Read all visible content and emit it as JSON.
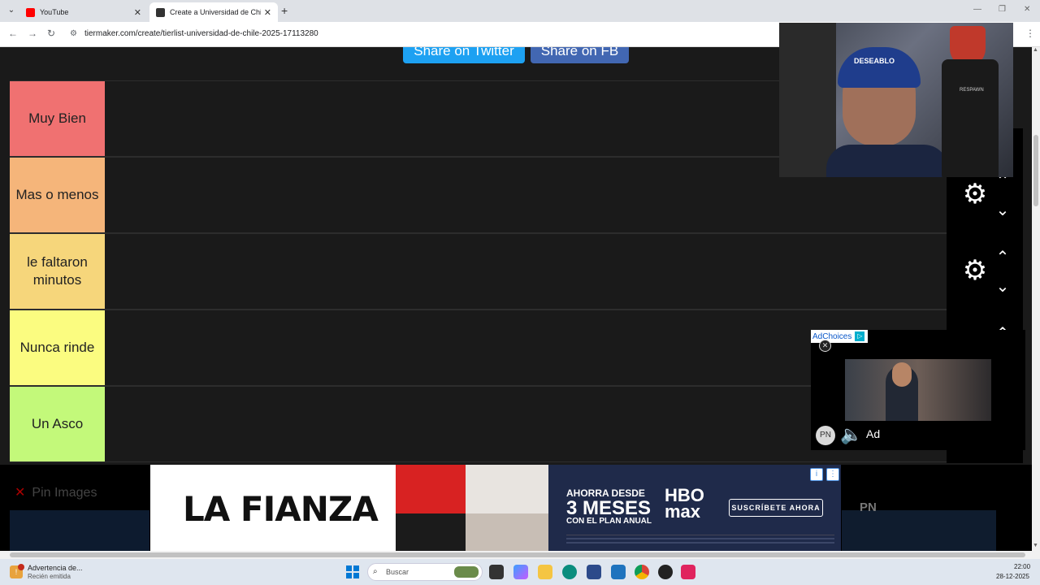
{
  "browser": {
    "tabs": [
      {
        "title": "YouTube",
        "active": false
      },
      {
        "title": "Create a Universidad de Chile Ti",
        "active": true
      }
    ],
    "url": "tiermaker.com/create/tierlist-universidad-de-chile-2025-17113280"
  },
  "share": {
    "twitter_label": "Share on Twitter",
    "facebook_label": "Share on FB"
  },
  "tiers": [
    {
      "label": "Muy Bien",
      "color": "#f07171"
    },
    {
      "label": "Mas o menos",
      "color": "#f5b57a"
    },
    {
      "label": "le faltaron minutos",
      "color": "#f6d67b"
    },
    {
      "label": "Nunca rinde",
      "color": "#fbfc80"
    },
    {
      "label": "Un Asco",
      "color": "#c3f97a"
    }
  ],
  "webcam": {
    "cap_text": "DESEABLO",
    "mic_brand": "RESPAWN"
  },
  "ad_popup": {
    "adchoices_label": "AdChoices",
    "badge": "PN",
    "ad_label": "Ad"
  },
  "bottom": {
    "pin_images_label": "Pin Images",
    "banner_title": "LA FIANZA",
    "promo_line1": "AHORRA DESDE",
    "promo_line2": "3 MESES",
    "promo_line3": "CON EL PLAN ANUAL",
    "brand_top": "HBO",
    "brand_bottom": "max",
    "cta": "SUSCRÍBETE AHORA",
    "right_badge": "PN"
  },
  "taskbar": {
    "notification_title": "Advertencia de...",
    "notification_sub": "Recién emitida",
    "search_placeholder": "Buscar",
    "time": "22:00",
    "date": "28-12-2025"
  }
}
